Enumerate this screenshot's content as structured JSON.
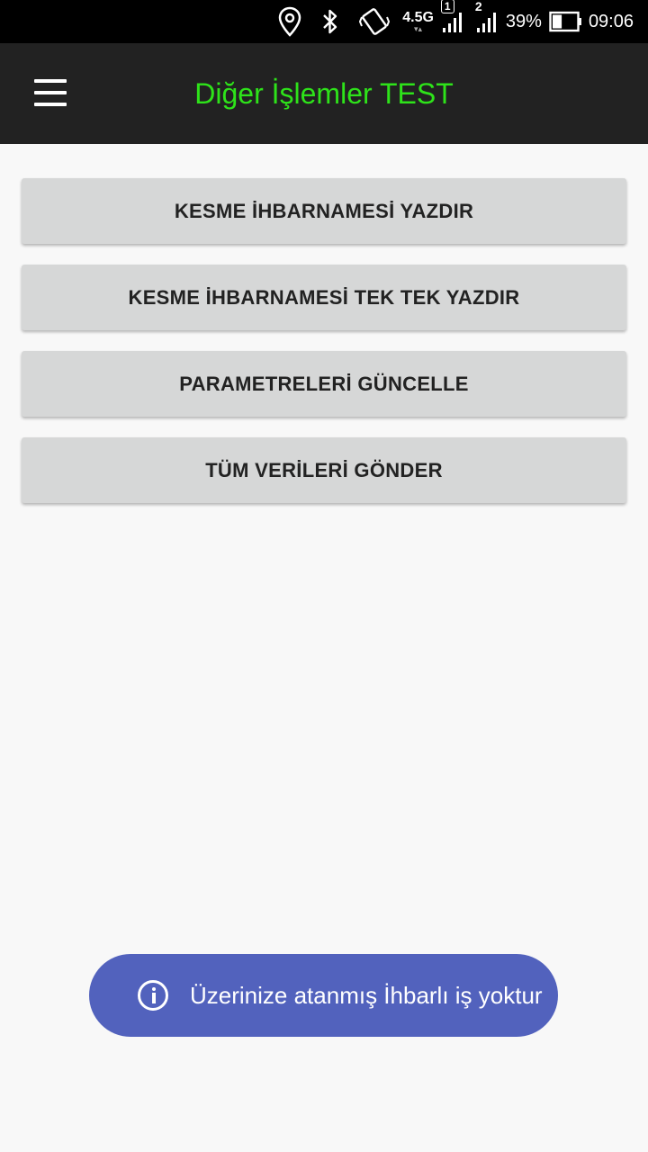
{
  "status_bar": {
    "icons": [
      "location-icon",
      "bluetooth-icon",
      "vibrate-icon",
      "network-4.5g-icon",
      "signal-sim1-icon",
      "signal-sim2-icon",
      "battery-icon"
    ],
    "network_type": "4.5G",
    "sim1_label": "1",
    "sim2_label": "2",
    "battery_percent": "39%",
    "battery_level": 0.39,
    "time": "09:06"
  },
  "app_bar": {
    "title": "Diğer İşlemler TEST",
    "title_color": "#2ee31a",
    "background": "#222222",
    "menu_icon": "hamburger-menu-icon"
  },
  "actions": [
    {
      "label": "KESME İHBARNAMESİ YAZDIR"
    },
    {
      "label": "KESME İHBARNAMESİ TEK TEK YAZDIR"
    },
    {
      "label": "PARAMETRELERİ GÜNCELLE"
    },
    {
      "label": "TÜM VERİLERİ GÖNDER"
    }
  ],
  "toast": {
    "icon": "info-icon",
    "message": "Üzerinize atanmış İhbarlı iş yoktur",
    "background": "#5262bd"
  }
}
